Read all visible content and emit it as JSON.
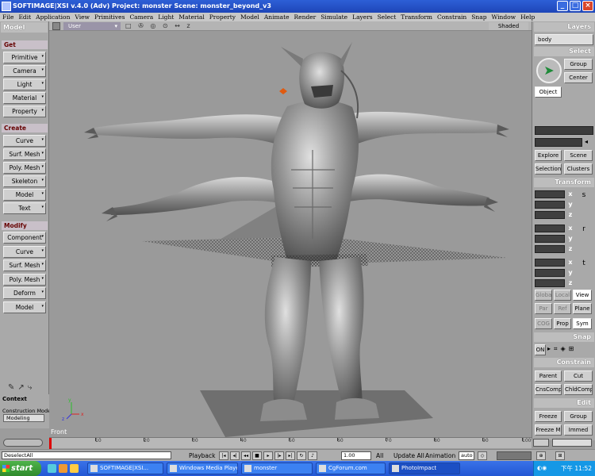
{
  "window": {
    "title": "SOFTIMAGE|XSI v.4.0 (Adv) Project: monster   Scene: monster_beyond_v3",
    "buttons": [
      "_",
      "□",
      "×"
    ]
  },
  "menu": [
    "File",
    "Edit",
    "Application",
    "View",
    "Primitives",
    "Camera",
    "Light",
    "Material",
    "Property",
    "Model",
    "Animate",
    "Render",
    "Simulate",
    "Layers",
    "Select",
    "Transform",
    "Constrain",
    "Snap",
    "Window",
    "Help"
  ],
  "left_toolbar": {
    "title": "Model",
    "sections": [
      {
        "label": "Get",
        "buttons": [
          "Primitive",
          "Camera",
          "Light",
          "Material",
          "Property"
        ]
      },
      {
        "label": "Create",
        "buttons": [
          "Curve",
          "Surf. Mesh",
          "Poly. Mesh",
          "Skeleton",
          "Model",
          "Text"
        ]
      },
      {
        "label": "Modify",
        "buttons": [
          "Component",
          "Curve",
          "Surf. Mesh",
          "Poly. Mesh",
          "Deform",
          "Model"
        ]
      }
    ]
  },
  "context": {
    "label": "Context",
    "construction_mode_label": "Construction Mode",
    "construction_mode_value": "Modeling"
  },
  "viewport": {
    "view": "User",
    "display_mode": "Shaded",
    "header_icons": "□ ✇ ◎ ⊙ ↔ z",
    "label": "Front",
    "axes": [
      "x",
      "y",
      "z"
    ],
    "colors": {
      "background": "#9a9a9a",
      "model": "#8e8e8e",
      "ground": "#6a6a6a"
    }
  },
  "right_panel": {
    "layers": {
      "title": "Layers",
      "current": "body"
    },
    "select": {
      "title": "Select",
      "group": "Group",
      "center": "Center",
      "object": "Object",
      "explore": "Explore",
      "scene": "Scene",
      "selection": "Selection",
      "clusters": "Clusters"
    },
    "transform": {
      "title": "Transform",
      "rows": [
        {
          "axis": "x",
          "tool": "s"
        },
        {
          "axis": "y",
          "tool": ""
        },
        {
          "axis": "z",
          "tool": ""
        },
        {
          "axis": "x",
          "tool": "r"
        },
        {
          "axis": "y",
          "tool": ""
        },
        {
          "axis": "z",
          "tool": ""
        },
        {
          "axis": "x",
          "tool": "t"
        },
        {
          "axis": "y",
          "tool": ""
        },
        {
          "axis": "z",
          "tool": ""
        }
      ],
      "global": "Global",
      "local": "Local",
      "view": "View",
      "par": "Par",
      "ref": "Ref",
      "plane": "Plane",
      "cog": "COG",
      "prop": "Prop",
      "sym": "Sym"
    },
    "snap": {
      "title": "Snap",
      "on": "ON"
    },
    "constrain": {
      "title": "Constrain",
      "parent": "Parent",
      "cut": "Cut",
      "cnscomp": "CnsComp",
      "chldcomp": "ChldComp"
    },
    "edit": {
      "title": "Edit",
      "freeze": "Freeze",
      "group": "Group",
      "freeze_m": "Freeze M",
      "immed": "Immed"
    }
  },
  "timeline": {
    "ticks": [
      10,
      20,
      30,
      40,
      50,
      60,
      70,
      80,
      90
    ],
    "range_end": 100,
    "current_frame": 0
  },
  "playback": {
    "command": "DeselectAll",
    "label": "Playback",
    "frame_field": "1.00",
    "all": "All",
    "update_all": "Update All",
    "animation": "Animation",
    "auto": "auto"
  },
  "taskbar": {
    "start": "start",
    "tasks": [
      {
        "label": "SOFTIMAGE|XSI...",
        "active": false
      },
      {
        "label": "Windows Media Player",
        "active": false
      },
      {
        "label": "monster",
        "active": false
      },
      {
        "label": "CgForum.com",
        "active": false
      },
      {
        "label": "PhotoImpact",
        "active": true
      }
    ],
    "clock": "下午 11:52"
  }
}
